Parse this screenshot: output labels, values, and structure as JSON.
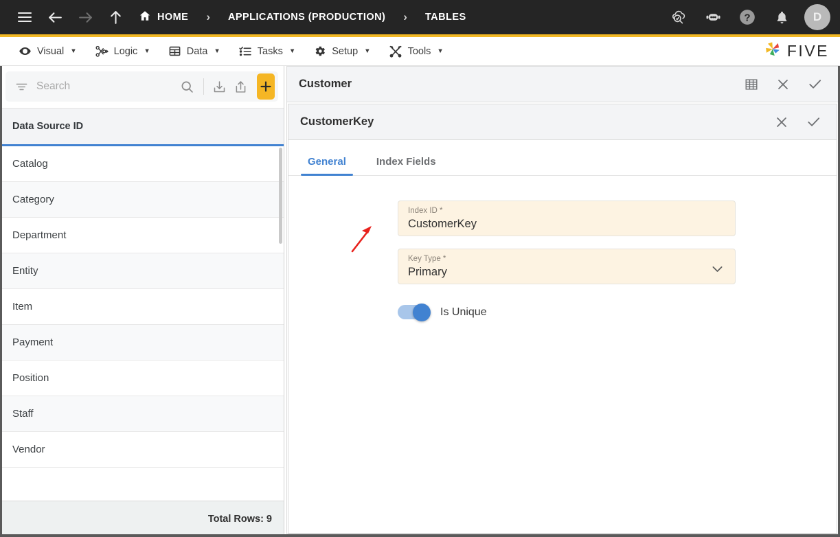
{
  "topbar": {
    "menu_icon": "hamburger-icon",
    "back_icon": "arrow-left-icon",
    "forward_icon": "arrow-right-icon",
    "up_icon": "arrow-up-icon",
    "breadcrumbs": [
      {
        "label": "HOME",
        "icon": "home-icon"
      },
      {
        "label": "APPLICATIONS (PRODUCTION)",
        "icon": ""
      },
      {
        "label": "TABLES",
        "icon": ""
      }
    ],
    "separator": "›",
    "actions": [
      {
        "name": "cloud-check-icon"
      },
      {
        "name": "robot-chat-icon"
      },
      {
        "name": "help-icon"
      },
      {
        "name": "bell-icon"
      }
    ],
    "avatar_initial": "D",
    "accent_color": "#f2b824"
  },
  "menubar": {
    "items": [
      {
        "label": "Visual",
        "icon": "eye-icon"
      },
      {
        "label": "Logic",
        "icon": "flow-nodes-icon"
      },
      {
        "label": "Data",
        "icon": "table-grid-icon"
      },
      {
        "label": "Tasks",
        "icon": "checklist-icon"
      },
      {
        "label": "Setup",
        "icon": "gear-icon"
      },
      {
        "label": "Tools",
        "icon": "wrench-screwdriver-icon"
      }
    ],
    "caret": "▼",
    "brand": "FIVE"
  },
  "sidebar": {
    "search_placeholder": "Search",
    "search_value": "",
    "filter_icon": "filter-icon",
    "search_icon": "search-icon",
    "import_icon": "import-download-icon",
    "export_icon": "export-share-icon",
    "add_label": "+",
    "column_header": "Data Source ID",
    "rows": [
      "Catalog",
      "Category",
      "Department",
      "Entity",
      "Item",
      "Payment",
      "Position",
      "Staff",
      "Vendor"
    ],
    "footer_total": "Total Rows: 9",
    "accent_underline": "#4182d1"
  },
  "record": {
    "parent_title": "Customer",
    "parent_actions": [
      {
        "name": "table-view-icon"
      },
      {
        "name": "close-icon"
      },
      {
        "name": "confirm-check-icon"
      }
    ],
    "child_title": "CustomerKey",
    "child_actions": [
      {
        "name": "close-icon"
      },
      {
        "name": "confirm-check-icon"
      }
    ],
    "tabs": [
      {
        "label": "General",
        "active": true
      },
      {
        "label": "Index Fields",
        "active": false
      }
    ],
    "fields": [
      {
        "label": "Index ID *",
        "value": "CustomerKey",
        "type": "text"
      },
      {
        "label": "Key Type *",
        "value": "Primary",
        "type": "select"
      }
    ],
    "toggle": {
      "label": "Is Unique",
      "checked": true,
      "color": "#4182d1"
    }
  },
  "annotation": {
    "type": "arrow",
    "color": "#e8211c",
    "points_to": "Index Fields"
  }
}
